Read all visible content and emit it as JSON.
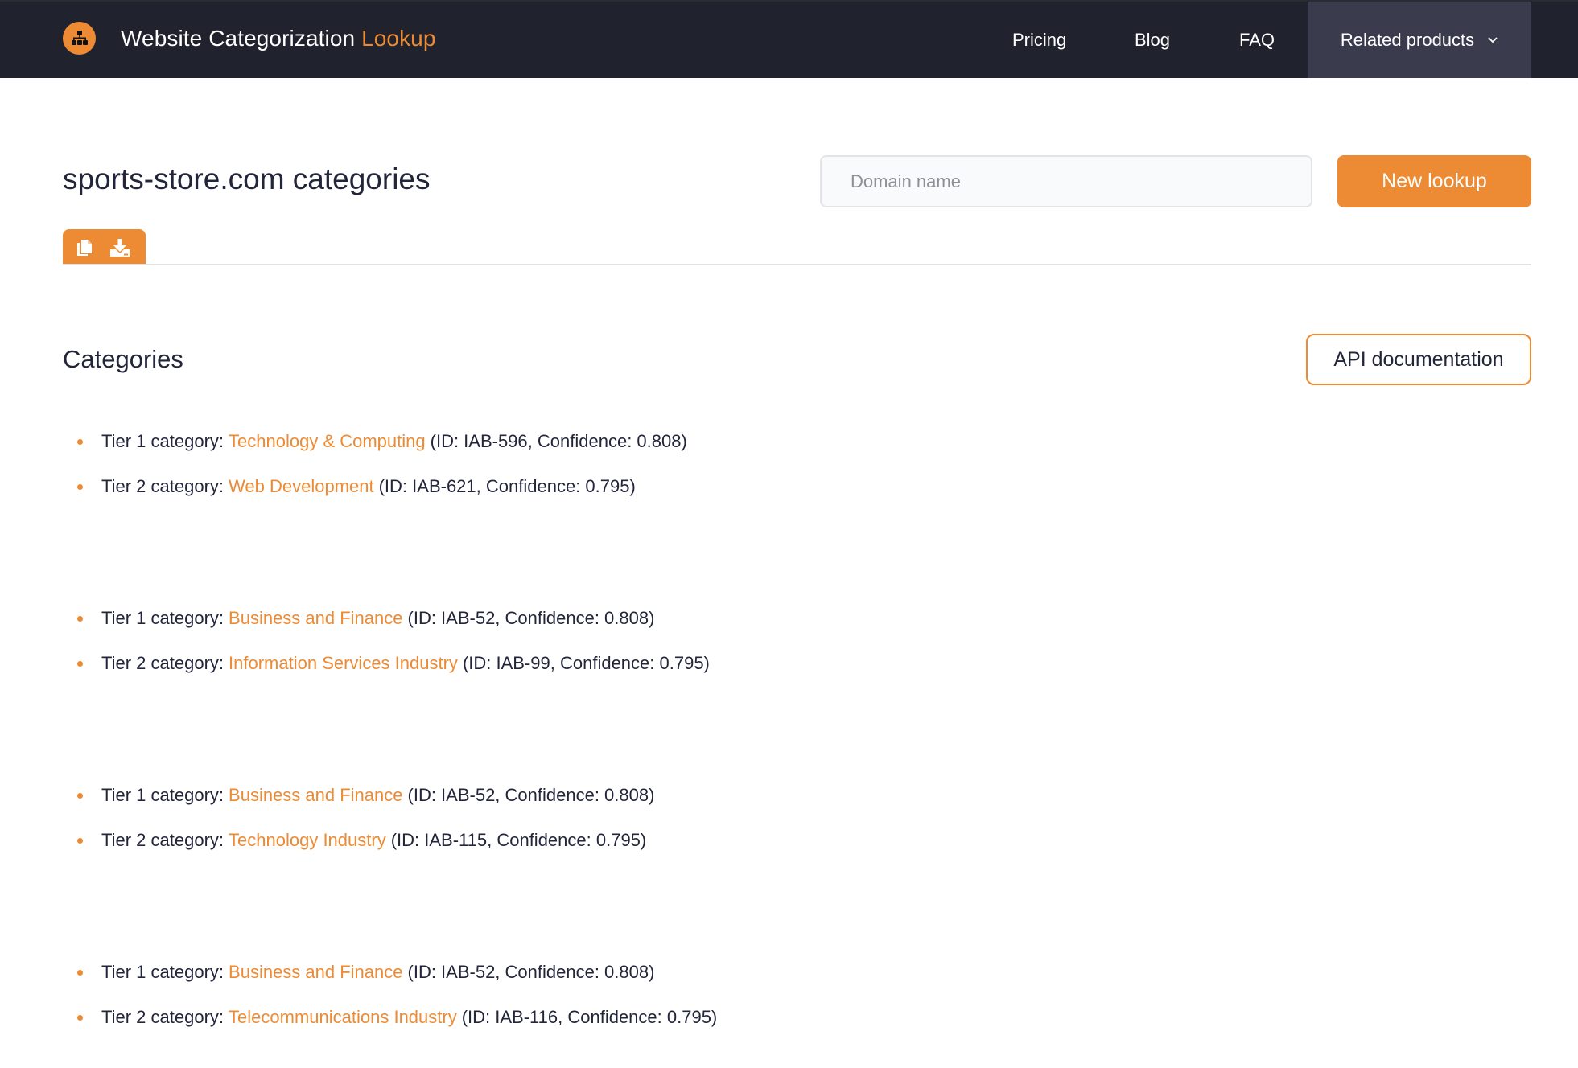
{
  "brand": {
    "name": "Website Categorization",
    "accent": "Lookup",
    "logo_icon": "sitemap-icon"
  },
  "nav": {
    "items": [
      {
        "label": "Pricing"
      },
      {
        "label": "Blog"
      },
      {
        "label": "FAQ"
      },
      {
        "label": "Related products",
        "icon": "chevron-down-icon"
      }
    ]
  },
  "page": {
    "title": "sports-store.com categories"
  },
  "lookup": {
    "placeholder": "Domain name",
    "value": "",
    "button_label": "New lookup"
  },
  "toolbar": {
    "icons": [
      "copy-icon",
      "download-icon"
    ]
  },
  "categories": {
    "section_title": "Categories",
    "api_button_label": "API documentation",
    "groups": [
      {
        "items": [
          {
            "prefix": "Tier 1 category:",
            "name": "Technology & Computing",
            "details": "(ID: IAB-596, Confidence: 0.808)"
          },
          {
            "prefix": "Tier 2 category:",
            "name": "Web Development",
            "details": "(ID: IAB-621, Confidence: 0.795)"
          }
        ]
      },
      {
        "items": [
          {
            "prefix": "Tier 1 category:",
            "name": "Business and Finance",
            "details": "(ID: IAB-52, Confidence: 0.808)"
          },
          {
            "prefix": "Tier 2 category:",
            "name": "Information Services Industry",
            "details": "(ID: IAB-99, Confidence: 0.795)"
          }
        ]
      },
      {
        "items": [
          {
            "prefix": "Tier 1 category:",
            "name": "Business and Finance",
            "details": "(ID: IAB-52, Confidence: 0.808)"
          },
          {
            "prefix": "Tier 2 category:",
            "name": "Technology Industry",
            "details": "(ID: IAB-115, Confidence: 0.795)"
          }
        ]
      },
      {
        "items": [
          {
            "prefix": "Tier 1 category:",
            "name": "Business and Finance",
            "details": "(ID: IAB-52, Confidence: 0.808)"
          },
          {
            "prefix": "Tier 2 category:",
            "name": "Telecommunications Industry",
            "details": "(ID: IAB-116, Confidence: 0.795)"
          }
        ]
      }
    ]
  },
  "colors": {
    "accent": "#ec8b34",
    "navbar_bg": "#20222e",
    "nav_active_bg": "#3a3b4d",
    "text": "#23263a"
  }
}
